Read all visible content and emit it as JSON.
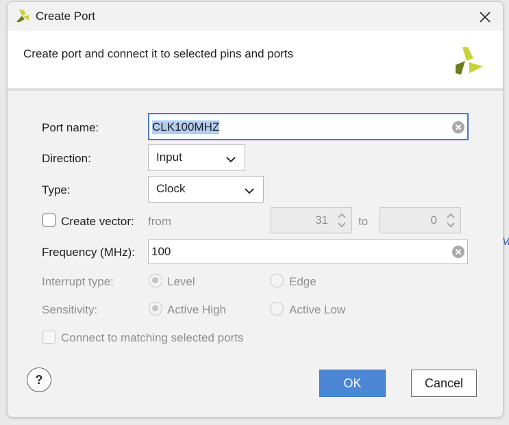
{
  "window": {
    "title": "Create Port",
    "subtitle": "Create port and connect it to selected pins and ports"
  },
  "form": {
    "port_name": {
      "label": "Port name:",
      "value": "CLK100MHZ"
    },
    "direction": {
      "label": "Direction:",
      "value": "Input"
    },
    "type": {
      "label": "Type:",
      "value": "Clock"
    },
    "create_vector": {
      "label": "Create vector:",
      "checked": false,
      "from_label": "from",
      "from_value": "31",
      "to_label": "to",
      "to_value": "0"
    },
    "frequency": {
      "label": "Frequency (MHz):",
      "value": "100"
    },
    "interrupt_type": {
      "label": "Interrupt type:",
      "options": [
        "Level",
        "Edge"
      ],
      "selected": "Level"
    },
    "sensitivity": {
      "label": "Sensitivity:",
      "options": [
        "Active High",
        "Active Low"
      ],
      "selected": "Active High"
    },
    "connect_matching": {
      "label": "Connect to matching selected ports",
      "checked": false
    }
  },
  "buttons": {
    "help": "?",
    "ok": "OK",
    "cancel": "Cancel"
  },
  "background": {
    "fragment_text": "Mo"
  },
  "colors": {
    "accent": "#4a86d4",
    "focus_border": "#4a79bf",
    "logo_light": "#c8d33a",
    "logo_dark": "#6b7d1c"
  },
  "icons": [
    "xilinx-logo-icon",
    "close-icon",
    "clear-icon",
    "chevron-down-icon",
    "spin-up-icon",
    "spin-down-icon",
    "help-icon"
  ]
}
